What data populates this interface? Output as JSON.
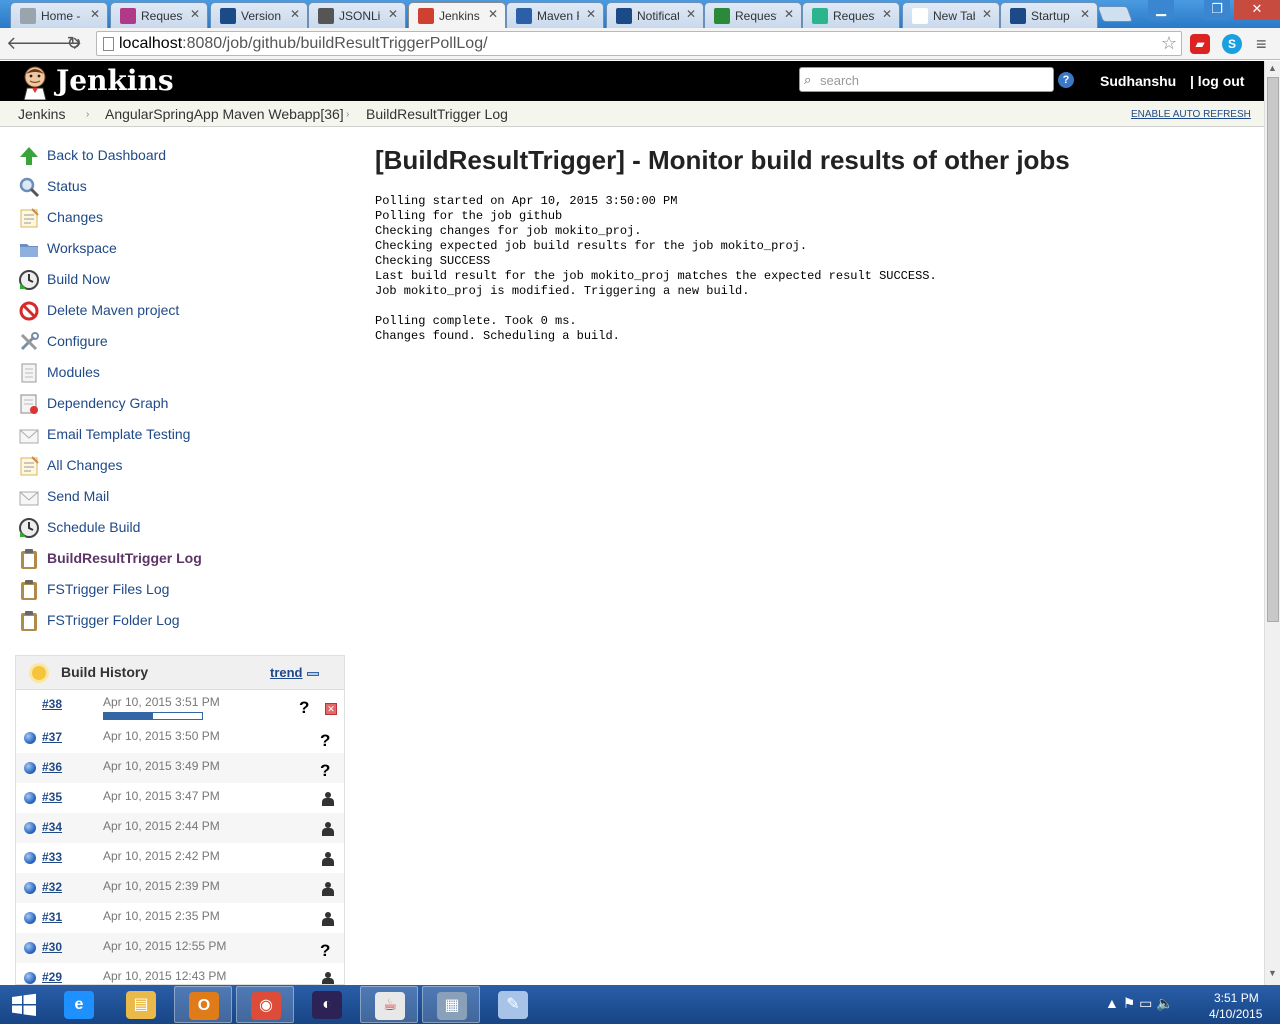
{
  "browser": {
    "tabs": [
      {
        "label": "Home -",
        "icon": "page-icon",
        "color": "#9aa4ad"
      },
      {
        "label": "Request",
        "icon": "request-icon",
        "color": "#b03a88"
      },
      {
        "label": "Version",
        "icon": "jira-icon",
        "color": "#1c4a86"
      },
      {
        "label": "JSONLint",
        "icon": "json-icon",
        "color": "#555555"
      },
      {
        "label": "Jenkins",
        "icon": "jenkins-icon",
        "color": "#d04030"
      },
      {
        "label": "Maven R",
        "icon": "mvn-icon",
        "color": "#2b5fa8"
      },
      {
        "label": "Notificati",
        "icon": "jira-icon",
        "color": "#1c4a86"
      },
      {
        "label": "Request",
        "icon": "globe-icon",
        "color": "#2a8a3a"
      },
      {
        "label": "Request",
        "icon": "request-icon",
        "color": "#2cb58d"
      },
      {
        "label": "New Tab",
        "icon": "blank-icon",
        "color": "#ffffff"
      },
      {
        "label": "Startup",
        "icon": "jira-icon",
        "color": "#1c4a86"
      }
    ],
    "active_tab": 4,
    "close_glyph": "✕",
    "url_host": "localhost",
    "url_rest": ":8080/job/github/buildResultTriggerPollLog/",
    "back_glyph": "🡐",
    "forward_glyph": "🡒",
    "reload_glyph": "↻",
    "star_glyph": "☆",
    "menu_glyph": "≡",
    "window_min": "▁",
    "window_max": "❐",
    "window_close": "✕"
  },
  "jenkins": {
    "title": "Jenkins",
    "search_placeholder": "search",
    "help": "?",
    "user": "Sudhanshu",
    "logout": "| log out"
  },
  "breadcrumb": {
    "items": [
      "Jenkins",
      "AngularSpringApp Maven Webapp[36]",
      "BuildResultTrigger Log"
    ],
    "separator": "›",
    "auto_refresh": "ENABLE AUTO REFRESH"
  },
  "sidepanel": {
    "tasks": [
      {
        "label": "Back to Dashboard",
        "icon": "up-arrow-icon"
      },
      {
        "label": "Status",
        "icon": "magnifier-icon"
      },
      {
        "label": "Changes",
        "icon": "notepad-icon"
      },
      {
        "label": "Workspace",
        "icon": "folder-icon"
      },
      {
        "label": "Build Now",
        "icon": "clock-icon"
      },
      {
        "label": "Delete Maven project",
        "icon": "no-entry-icon"
      },
      {
        "label": "Configure",
        "icon": "tools-icon"
      },
      {
        "label": "Modules",
        "icon": "document-icon"
      },
      {
        "label": "Dependency Graph",
        "icon": "graph-icon"
      },
      {
        "label": "Email Template Testing",
        "icon": "envelope-icon"
      },
      {
        "label": "All Changes",
        "icon": "notepad-icon"
      },
      {
        "label": "Send Mail",
        "icon": "envelope-icon"
      },
      {
        "label": "Schedule Build",
        "icon": "clock-icon"
      },
      {
        "label": "BuildResultTrigger Log",
        "icon": "clipboard-icon"
      },
      {
        "label": "FSTrigger Files Log",
        "icon": "clipboard-icon"
      },
      {
        "label": "FSTrigger Folder Log",
        "icon": "clipboard-icon"
      }
    ],
    "current_task": 13
  },
  "build_history": {
    "title": "Build History",
    "trend": "trend",
    "running": {
      "number": "#38",
      "date": "Apr 10, 2015 3:51 PM",
      "cause": "?",
      "progress": 0.5,
      "stop": "✕"
    },
    "builds": [
      {
        "number": "#37",
        "date": "Apr 10, 2015 3:50 PM",
        "cause": "question"
      },
      {
        "number": "#36",
        "date": "Apr 10, 2015 3:49 PM",
        "cause": "question"
      },
      {
        "number": "#35",
        "date": "Apr 10, 2015 3:47 PM",
        "cause": "user"
      },
      {
        "number": "#34",
        "date": "Apr 10, 2015 2:44 PM",
        "cause": "user"
      },
      {
        "number": "#33",
        "date": "Apr 10, 2015 2:42 PM",
        "cause": "user"
      },
      {
        "number": "#32",
        "date": "Apr 10, 2015 2:39 PM",
        "cause": "user"
      },
      {
        "number": "#31",
        "date": "Apr 10, 2015 2:35 PM",
        "cause": "user"
      },
      {
        "number": "#30",
        "date": "Apr 10, 2015 12:55 PM",
        "cause": "question"
      },
      {
        "number": "#29",
        "date": "Apr 10, 2015 12:43 PM",
        "cause": "user"
      }
    ],
    "question_glyph": "?"
  },
  "main": {
    "title": "[BuildResultTrigger] - Monitor build results of other jobs",
    "log_lines": [
      "Polling started on Apr 10, 2015 3:50:00 PM",
      "Polling for the job github",
      "Checking changes for job mokito_proj.",
      "Checking expected job build results for the job mokito_proj.",
      "Checking SUCCESS",
      "Last build result for the job mokito_proj matches the expected result SUCCESS.",
      "Job mokito_proj is modified. Triggering a new build.",
      "",
      "Polling complete. Took 0 ms.",
      "Changes found. Scheduling a build."
    ]
  },
  "taskbar": {
    "apps": [
      {
        "name": "internet-explorer-icon",
        "glyph": "e",
        "color": "#1e90ff",
        "active": false
      },
      {
        "name": "file-explorer-icon",
        "glyph": "▤",
        "color": "#e9b949",
        "active": false
      },
      {
        "name": "outlook-icon",
        "glyph": "O",
        "color": "#e07b1a",
        "active": true
      },
      {
        "name": "chrome-icon",
        "glyph": "◉",
        "color": "#dd4b39",
        "active": true
      },
      {
        "name": "eclipse-icon",
        "glyph": "◐",
        "color": "#2c2255",
        "active": false
      },
      {
        "name": "java-icon",
        "glyph": "☕",
        "color": "#e8e8e8",
        "active": true
      },
      {
        "name": "resource-monitor-icon",
        "glyph": "▦",
        "color": "#8aa0b8",
        "active": true
      },
      {
        "name": "paint-icon",
        "glyph": "✎",
        "color": "#a7c3e8",
        "active": false
      }
    ],
    "tray": "▲  ⚑  ▭  🔈",
    "time": "3:51 PM",
    "date": "4/10/2015"
  }
}
